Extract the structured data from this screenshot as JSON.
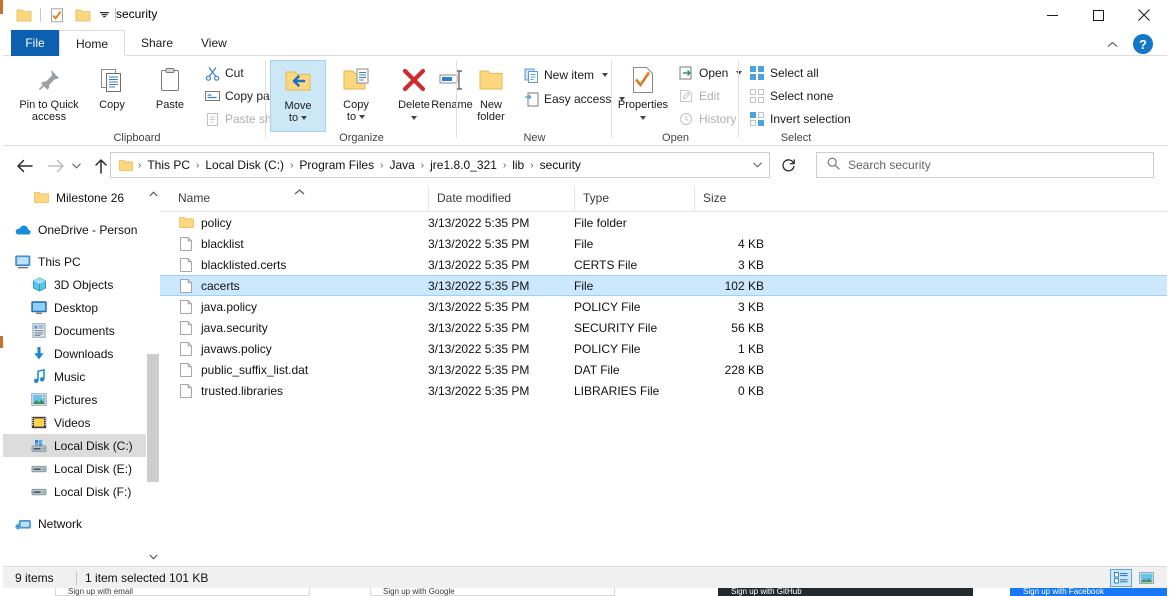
{
  "window": {
    "title": "security",
    "minimize_label": "Minimize",
    "maximize_label": "Maximize",
    "close_label": "Close",
    "help_label": "?",
    "quick_access": [
      "folder-icon",
      "properties-icon",
      "new-folder-icon",
      "customize-dropdown"
    ]
  },
  "tabs": [
    {
      "label": "File",
      "selected": false
    },
    {
      "label": "Home",
      "selected": true
    },
    {
      "label": "Share",
      "selected": false
    },
    {
      "label": "View",
      "selected": false
    }
  ],
  "ribbon": {
    "groups": [
      {
        "name": "Clipboard",
        "label": "Clipboard"
      },
      {
        "name": "Organize",
        "label": "Organize"
      },
      {
        "name": "New",
        "label": "New"
      },
      {
        "name": "Open",
        "label": "Open"
      },
      {
        "name": "Select",
        "label": "Select"
      }
    ],
    "clipboard": {
      "pin_label": "Pin to Quick\naccess",
      "pin_line1": "Pin to Quick",
      "pin_line2": "access",
      "copy_label": "Copy",
      "paste_label": "Paste",
      "cut_label": "Cut",
      "copy_path_label": "Copy path",
      "paste_shortcut_label": "Paste shortcut"
    },
    "organize": {
      "move_to_line1": "Move",
      "move_to_line2": "to",
      "copy_to_line1": "Copy",
      "copy_to_line2": "to",
      "delete_label": "Delete",
      "rename_label": "Rename"
    },
    "new": {
      "new_folder_line1": "New",
      "new_folder_line2": "folder",
      "new_item_label": "New item",
      "easy_access_label": "Easy access"
    },
    "open_group": {
      "properties_label": "Properties",
      "open_label": "Open",
      "edit_label": "Edit",
      "history_label": "History"
    },
    "select": {
      "select_all_label": "Select all",
      "select_none_label": "Select none",
      "invert_selection_label": "Invert selection"
    }
  },
  "navigation": {
    "back_label": "Back",
    "forward_label": "Forward",
    "recent_label": "Recent locations",
    "up_label": "Up",
    "refresh_label": "Refresh",
    "breadcrumbs": [
      "This PC",
      "Local Disk (C:)",
      "Program Files",
      "Java",
      "jre1.8.0_321",
      "lib",
      "security"
    ]
  },
  "search": {
    "placeholder": "Search security"
  },
  "sidebar": {
    "items": [
      {
        "label": "Milestone 26",
        "icon": "folder-icon",
        "indent": 1,
        "selected": false
      },
      {
        "label": "OneDrive - Person",
        "icon": "onedrive-icon",
        "indent": 0,
        "selected": false
      },
      {
        "label": "This PC",
        "icon": "this-pc-icon",
        "indent": 0,
        "selected": false
      },
      {
        "label": "3D Objects",
        "icon": "3d-objects-icon",
        "indent": 1,
        "selected": false
      },
      {
        "label": "Desktop",
        "icon": "desktop-icon",
        "indent": 1,
        "selected": false
      },
      {
        "label": "Documents",
        "icon": "documents-icon",
        "indent": 1,
        "selected": false
      },
      {
        "label": "Downloads",
        "icon": "downloads-icon",
        "indent": 1,
        "selected": false
      },
      {
        "label": "Music",
        "icon": "music-icon",
        "indent": 1,
        "selected": false
      },
      {
        "label": "Pictures",
        "icon": "pictures-icon",
        "indent": 1,
        "selected": false
      },
      {
        "label": "Videos",
        "icon": "videos-icon",
        "indent": 1,
        "selected": false
      },
      {
        "label": "Local Disk (C:)",
        "icon": "local-disk-c-icon",
        "indent": 1,
        "selected": true
      },
      {
        "label": "Local Disk (E:)",
        "icon": "drive-icon",
        "indent": 1,
        "selected": false
      },
      {
        "label": "Local Disk (F:)",
        "icon": "drive-icon",
        "indent": 1,
        "selected": false
      },
      {
        "label": "Network",
        "icon": "network-icon",
        "indent": 0,
        "selected": false
      }
    ]
  },
  "file_list": {
    "columns": [
      {
        "label": "Name"
      },
      {
        "label": "Date modified"
      },
      {
        "label": "Type"
      },
      {
        "label": "Size"
      }
    ],
    "sort_column": "Name",
    "sort_direction": "ascending",
    "rows": [
      {
        "name": "policy",
        "date": "3/13/2022 5:35 PM",
        "type": "File folder",
        "size": "",
        "icon": "folder-icon",
        "selected": false
      },
      {
        "name": "blacklist",
        "date": "3/13/2022 5:35 PM",
        "type": "File",
        "size": "4 KB",
        "icon": "file-icon",
        "selected": false
      },
      {
        "name": "blacklisted.certs",
        "date": "3/13/2022 5:35 PM",
        "type": "CERTS File",
        "size": "3 KB",
        "icon": "file-icon",
        "selected": false
      },
      {
        "name": "cacerts",
        "date": "3/13/2022 5:35 PM",
        "type": "File",
        "size": "102 KB",
        "icon": "file-icon",
        "selected": true
      },
      {
        "name": "java.policy",
        "date": "3/13/2022 5:35 PM",
        "type": "POLICY File",
        "size": "3 KB",
        "icon": "file-icon",
        "selected": false
      },
      {
        "name": "java.security",
        "date": "3/13/2022 5:35 PM",
        "type": "SECURITY File",
        "size": "56 KB",
        "icon": "file-icon",
        "selected": false
      },
      {
        "name": "javaws.policy",
        "date": "3/13/2022 5:35 PM",
        "type": "POLICY File",
        "size": "1 KB",
        "icon": "file-icon",
        "selected": false
      },
      {
        "name": "public_suffix_list.dat",
        "date": "3/13/2022 5:35 PM",
        "type": "DAT File",
        "size": "228 KB",
        "icon": "file-icon",
        "selected": false
      },
      {
        "name": "trusted.libraries",
        "date": "3/13/2022 5:35 PM",
        "type": "LIBRARIES File",
        "size": "0 KB",
        "icon": "file-icon",
        "selected": false
      }
    ]
  },
  "status_bar": {
    "item_count": "9 items",
    "selection": "1 item selected  101 KB",
    "details_view_label": "Details view",
    "thumbnail_view_label": "Large icons view"
  },
  "background_page": {
    "buttons": [
      "Sign up with email",
      "Sign up with Google",
      "Sign up with GitHub",
      "Sign up with Facebook"
    ]
  },
  "colors": {
    "accent": "#0d5faf",
    "selection": "#cce8ff",
    "selection_border": "#99d1ff",
    "hover": "#cce8f7",
    "folder": "#fcd77f",
    "help": "#1277c8"
  }
}
